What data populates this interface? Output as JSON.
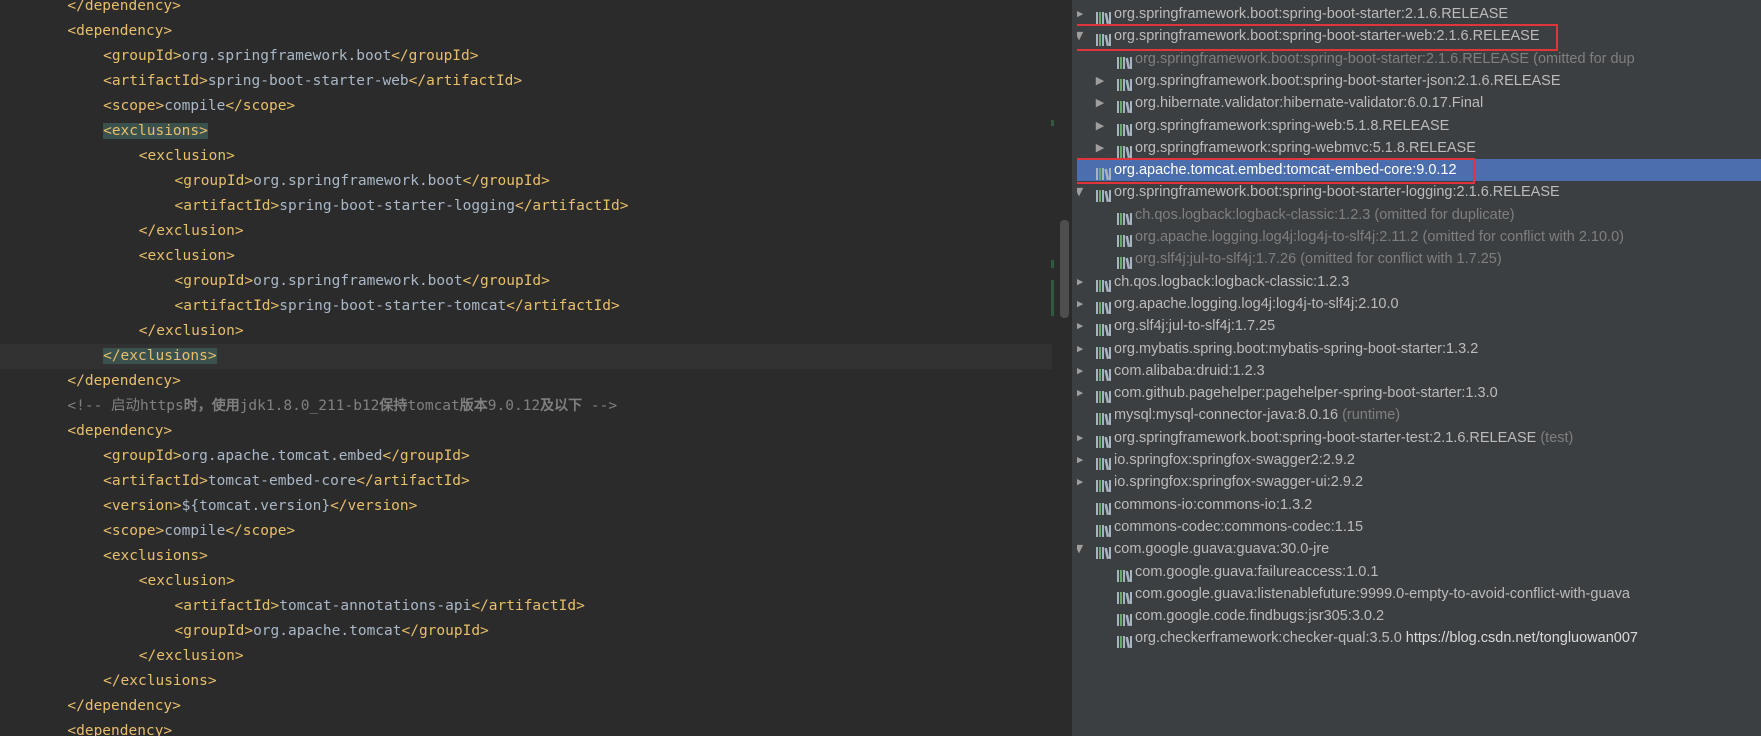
{
  "colors": {
    "editor_bg": "#2b2b2b",
    "tag": "#e8bf6a",
    "text": "#a9b7c6",
    "comment": "#808080",
    "tree_bg": "#3c3f41",
    "tree_text": "#bbbbbb",
    "selected_row": "#4b6eaf",
    "highlight_box": "#e0353b"
  },
  "editor": {
    "lines": [
      {
        "indent": 2,
        "tokens": [
          {
            "t": "</dependency>",
            "k": "tg"
          }
        ]
      },
      {
        "indent": 2,
        "tokens": [
          {
            "t": "<dependency>",
            "k": "tg"
          }
        ]
      },
      {
        "indent": 3,
        "tokens": [
          {
            "t": "<groupId>",
            "k": "tg"
          },
          {
            "t": "org.springframework.boot",
            "k": "tx"
          },
          {
            "t": "</groupId>",
            "k": "tg"
          }
        ]
      },
      {
        "indent": 3,
        "tokens": [
          {
            "t": "<artifactId>",
            "k": "tg"
          },
          {
            "t": "spring-boot-starter-web",
            "k": "tx"
          },
          {
            "t": "</artifactId>",
            "k": "tg"
          }
        ]
      },
      {
        "indent": 3,
        "tokens": [
          {
            "t": "<scope>",
            "k": "tg"
          },
          {
            "t": "compile",
            "k": "tx"
          },
          {
            "t": "</scope>",
            "k": "tg"
          }
        ]
      },
      {
        "indent": 3,
        "tokens": [
          {
            "t": "<exclusions>",
            "k": "tg hl"
          }
        ]
      },
      {
        "indent": 4,
        "tokens": [
          {
            "t": "<exclusion>",
            "k": "tg"
          }
        ]
      },
      {
        "indent": 5,
        "tokens": [
          {
            "t": "<groupId>",
            "k": "tg"
          },
          {
            "t": "org.springframework.boot",
            "k": "tx"
          },
          {
            "t": "</groupId>",
            "k": "tg"
          }
        ]
      },
      {
        "indent": 5,
        "tokens": [
          {
            "t": "<artifactId>",
            "k": "tg"
          },
          {
            "t": "spring-boot-starter-logging",
            "k": "tx"
          },
          {
            "t": "</artifactId>",
            "k": "tg"
          }
        ]
      },
      {
        "indent": 4,
        "tokens": [
          {
            "t": "</exclusion>",
            "k": "tg"
          }
        ]
      },
      {
        "indent": 4,
        "tokens": [
          {
            "t": "<exclusion>",
            "k": "tg"
          }
        ]
      },
      {
        "indent": 5,
        "tokens": [
          {
            "t": "<groupId>",
            "k": "tg"
          },
          {
            "t": "org.springframework.boot",
            "k": "tx"
          },
          {
            "t": "</groupId>",
            "k": "tg"
          }
        ]
      },
      {
        "indent": 5,
        "tokens": [
          {
            "t": "<artifactId>",
            "k": "tg"
          },
          {
            "t": "spring-boot-starter-tomcat",
            "k": "tx"
          },
          {
            "t": "</artifactId>",
            "k": "tg"
          }
        ]
      },
      {
        "indent": 4,
        "tokens": [
          {
            "t": "</exclusion>",
            "k": "tg"
          }
        ]
      },
      {
        "indent": 3,
        "current": true,
        "tokens": [
          {
            "t": "</exclusions>",
            "k": "tg hl"
          }
        ]
      },
      {
        "indent": 2,
        "tokens": [
          {
            "t": "</dependency>",
            "k": "tg"
          }
        ]
      },
      {
        "indent": 2,
        "tokens": [
          {
            "t": "<!-- 启动",
            "k": "cm"
          },
          {
            "t": "https",
            "k": "cm"
          },
          {
            "t": "时，使用",
            "k": "cmb"
          },
          {
            "t": "jdk1.8.0_211-b12",
            "k": "cm"
          },
          {
            "t": "保持",
            "k": "cmb"
          },
          {
            "t": "tomcat",
            "k": "cm"
          },
          {
            "t": "版本",
            "k": "cmb"
          },
          {
            "t": "9.0.12",
            "k": "cm"
          },
          {
            "t": "及以下",
            "k": "cmb"
          },
          {
            "t": " -->",
            "k": "cm"
          }
        ]
      },
      {
        "indent": 2,
        "tokens": [
          {
            "t": "<dependency>",
            "k": "tg"
          }
        ]
      },
      {
        "indent": 3,
        "tokens": [
          {
            "t": "<groupId>",
            "k": "tg"
          },
          {
            "t": "org.apache.tomcat.embed",
            "k": "tx"
          },
          {
            "t": "</groupId>",
            "k": "tg"
          }
        ]
      },
      {
        "indent": 3,
        "tokens": [
          {
            "t": "<artifactId>",
            "k": "tg"
          },
          {
            "t": "tomcat-embed-core",
            "k": "tx"
          },
          {
            "t": "</artifactId>",
            "k": "tg"
          }
        ]
      },
      {
        "indent": 3,
        "tokens": [
          {
            "t": "<version>",
            "k": "tg"
          },
          {
            "t": "${tomcat.version}",
            "k": "tx"
          },
          {
            "t": "</version>",
            "k": "tg"
          }
        ]
      },
      {
        "indent": 3,
        "tokens": [
          {
            "t": "<scope>",
            "k": "tg"
          },
          {
            "t": "compile",
            "k": "tx"
          },
          {
            "t": "</scope>",
            "k": "tg"
          }
        ]
      },
      {
        "indent": 3,
        "tokens": [
          {
            "t": "<exclusions>",
            "k": "tg"
          }
        ]
      },
      {
        "indent": 4,
        "tokens": [
          {
            "t": "<exclusion>",
            "k": "tg"
          }
        ]
      },
      {
        "indent": 5,
        "tokens": [
          {
            "t": "<artifactId>",
            "k": "tg"
          },
          {
            "t": "tomcat-annotations-api",
            "k": "tx"
          },
          {
            "t": "</artifactId>",
            "k": "tg"
          }
        ]
      },
      {
        "indent": 5,
        "tokens": [
          {
            "t": "<groupId>",
            "k": "tg"
          },
          {
            "t": "org.apache.tomcat",
            "k": "tx"
          },
          {
            "t": "</groupId>",
            "k": "tg"
          }
        ]
      },
      {
        "indent": 4,
        "tokens": [
          {
            "t": "</exclusion>",
            "k": "tg"
          }
        ]
      },
      {
        "indent": 3,
        "tokens": [
          {
            "t": "</exclusions>",
            "k": "tg"
          }
        ]
      },
      {
        "indent": 2,
        "tokens": [
          {
            "t": "</dependency>",
            "k": "tg"
          }
        ]
      },
      {
        "indent": 2,
        "tokens": [
          {
            "t": "<dependency>",
            "k": "tg"
          }
        ]
      }
    ]
  },
  "tree": {
    "rows": [
      {
        "level": 0,
        "arrow": "right",
        "label": "org.springframework.boot:spring-boot-starter:2.1.6.RELEASE"
      },
      {
        "level": 0,
        "arrow": "down",
        "label": "org.springframework.boot:spring-boot-starter-web:2.1.6.RELEASE",
        "boxed": true
      },
      {
        "level": 1,
        "arrow": "",
        "label": "org.springframework.boot:spring-boot-starter:2.1.6.RELEASE",
        "note": " (omitted for dup",
        "dim": true
      },
      {
        "level": 1,
        "arrow": "right",
        "label": "org.springframework.boot:spring-boot-starter-json:2.1.6.RELEASE"
      },
      {
        "level": 1,
        "arrow": "right",
        "label": "org.hibernate.validator:hibernate-validator:6.0.17.Final"
      },
      {
        "level": 1,
        "arrow": "right",
        "label": "org.springframework:spring-web:5.1.8.RELEASE"
      },
      {
        "level": 1,
        "arrow": "right",
        "label": "org.springframework:spring-webmvc:5.1.8.RELEASE"
      },
      {
        "level": 0,
        "arrow": "",
        "label": "org.apache.tomcat.embed:tomcat-embed-core:9.0.12",
        "selected": true,
        "boxed": true
      },
      {
        "level": 0,
        "arrow": "down",
        "label": "org.springframework.boot:spring-boot-starter-logging:2.1.6.RELEASE"
      },
      {
        "level": 1,
        "arrow": "",
        "label": "ch.qos.logback:logback-classic:1.2.3",
        "note": " (omitted for duplicate)",
        "dim": true
      },
      {
        "level": 1,
        "arrow": "",
        "label": "org.apache.logging.log4j:log4j-to-slf4j:2.11.2",
        "note": " (omitted for conflict with 2.10.0)",
        "dim": true
      },
      {
        "level": 1,
        "arrow": "",
        "label": "org.slf4j:jul-to-slf4j:1.7.26",
        "note": " (omitted for conflict with 1.7.25)",
        "dim": true
      },
      {
        "level": 0,
        "arrow": "right",
        "label": "ch.qos.logback:logback-classic:1.2.3"
      },
      {
        "level": 0,
        "arrow": "right",
        "label": "org.apache.logging.log4j:log4j-to-slf4j:2.10.0"
      },
      {
        "level": 0,
        "arrow": "right",
        "label": "org.slf4j:jul-to-slf4j:1.7.25"
      },
      {
        "level": 0,
        "arrow": "right",
        "label": "org.mybatis.spring.boot:mybatis-spring-boot-starter:1.3.2"
      },
      {
        "level": 0,
        "arrow": "right",
        "label": "com.alibaba:druid:1.2.3"
      },
      {
        "level": 0,
        "arrow": "right",
        "label": "com.github.pagehelper:pagehelper-spring-boot-starter:1.3.0"
      },
      {
        "level": 0,
        "arrow": "",
        "label": "mysql:mysql-connector-java:8.0.16",
        "note": " (runtime)"
      },
      {
        "level": 0,
        "arrow": "right",
        "label": "org.springframework.boot:spring-boot-starter-test:2.1.6.RELEASE",
        "note": " (test)"
      },
      {
        "level": 0,
        "arrow": "right",
        "label": "io.springfox:springfox-swagger2:2.9.2"
      },
      {
        "level": 0,
        "arrow": "right",
        "label": "io.springfox:springfox-swagger-ui:2.9.2"
      },
      {
        "level": 0,
        "arrow": "",
        "label": "commons-io:commons-io:1.3.2"
      },
      {
        "level": 0,
        "arrow": "",
        "label": "commons-codec:commons-codec:1.15"
      },
      {
        "level": 0,
        "arrow": "down",
        "label": "com.google.guava:guava:30.0-jre"
      },
      {
        "level": 1,
        "arrow": "",
        "label": "com.google.guava:failureaccess:1.0.1"
      },
      {
        "level": 1,
        "arrow": "",
        "label": "com.google.guava:listenablefuture:9999.0-empty-to-avoid-conflict-with-guava"
      },
      {
        "level": 1,
        "arrow": "",
        "label": "com.google.code.findbugs:jsr305:3.0.2"
      },
      {
        "level": 1,
        "arrow": "",
        "label": "org.checkerframework:checker-qual:3.5.0",
        "watermark": " https://blog.csdn.net/tongluowan007"
      }
    ]
  }
}
